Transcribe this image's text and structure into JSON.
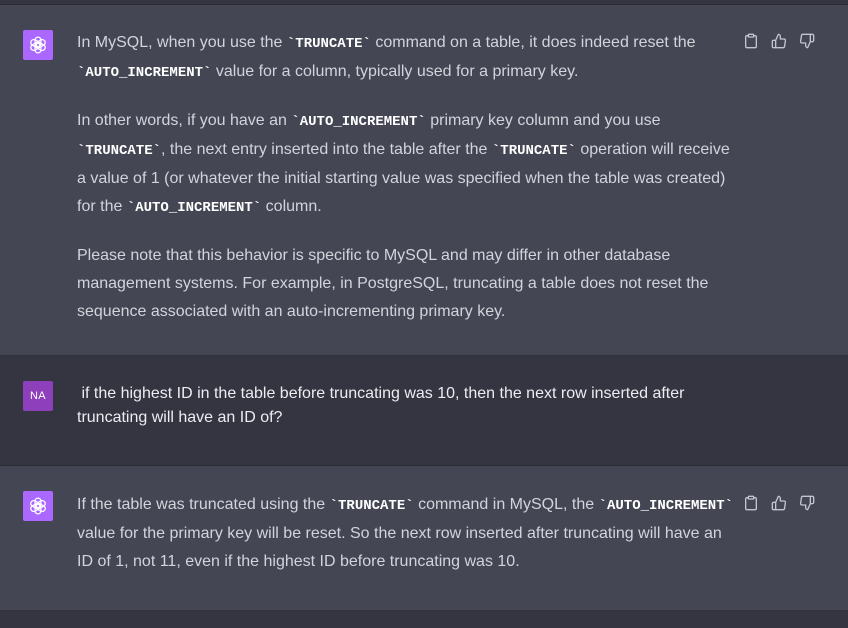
{
  "conversation": {
    "messages": [
      {
        "role": "assistant",
        "avatar_icon": "openai-logo-icon",
        "paragraphs": [
          [
            {
              "t": "In MySQL, when you use the "
            },
            {
              "c": "`TRUNCATE`"
            },
            {
              "t": " command on a table, it does indeed reset the "
            },
            {
              "c": "`AUTO_INCREMENT`"
            },
            {
              "t": " value for a column, typically used for a primary key."
            }
          ],
          [
            {
              "t": "In other words, if you have an "
            },
            {
              "c": "`AUTO_INCREMENT`"
            },
            {
              "t": " primary key column and you use "
            },
            {
              "c": "`TRUNCATE`"
            },
            {
              "t": ", the next entry inserted into the table after the "
            },
            {
              "c": "`TRUNCATE`"
            },
            {
              "t": " operation will receive a value of 1 (or whatever the initial starting value was specified when the table was created) for the "
            },
            {
              "c": "`AUTO_INCREMENT`"
            },
            {
              "t": " column."
            }
          ],
          [
            {
              "t": "Please note that this behavior is specific to MySQL and may differ in other database management systems. For example, in PostgreSQL, truncating a table does not reset the sequence associated with an auto-incrementing primary key."
            }
          ]
        ]
      },
      {
        "role": "user",
        "avatar_initials": "NA",
        "text": " if the highest ID in the table before truncating was 10, then the next row inserted after truncating will have an ID of?"
      },
      {
        "role": "assistant",
        "avatar_icon": "openai-logo-icon",
        "paragraphs": [
          [
            {
              "t": "If the table was truncated using the "
            },
            {
              "c": "`TRUNCATE`"
            },
            {
              "t": " command in MySQL, the "
            },
            {
              "c": "`AUTO_INCREMENT`"
            },
            {
              "t": " value for the primary key will be reset. So the next row inserted after truncating will have an ID of 1, not 11, even if the highest ID before truncating was 10."
            }
          ]
        ]
      }
    ]
  },
  "message_actions": [
    {
      "icon": "clipboard-icon"
    },
    {
      "icon": "thumbs-up-icon"
    },
    {
      "icon": "thumbs-down-icon"
    }
  ],
  "colors": {
    "assistant_bg": "#444654",
    "user_bg": "#343541",
    "gpt_avatar": "#ab68ff",
    "user_avatar": "#8e3fbb"
  }
}
